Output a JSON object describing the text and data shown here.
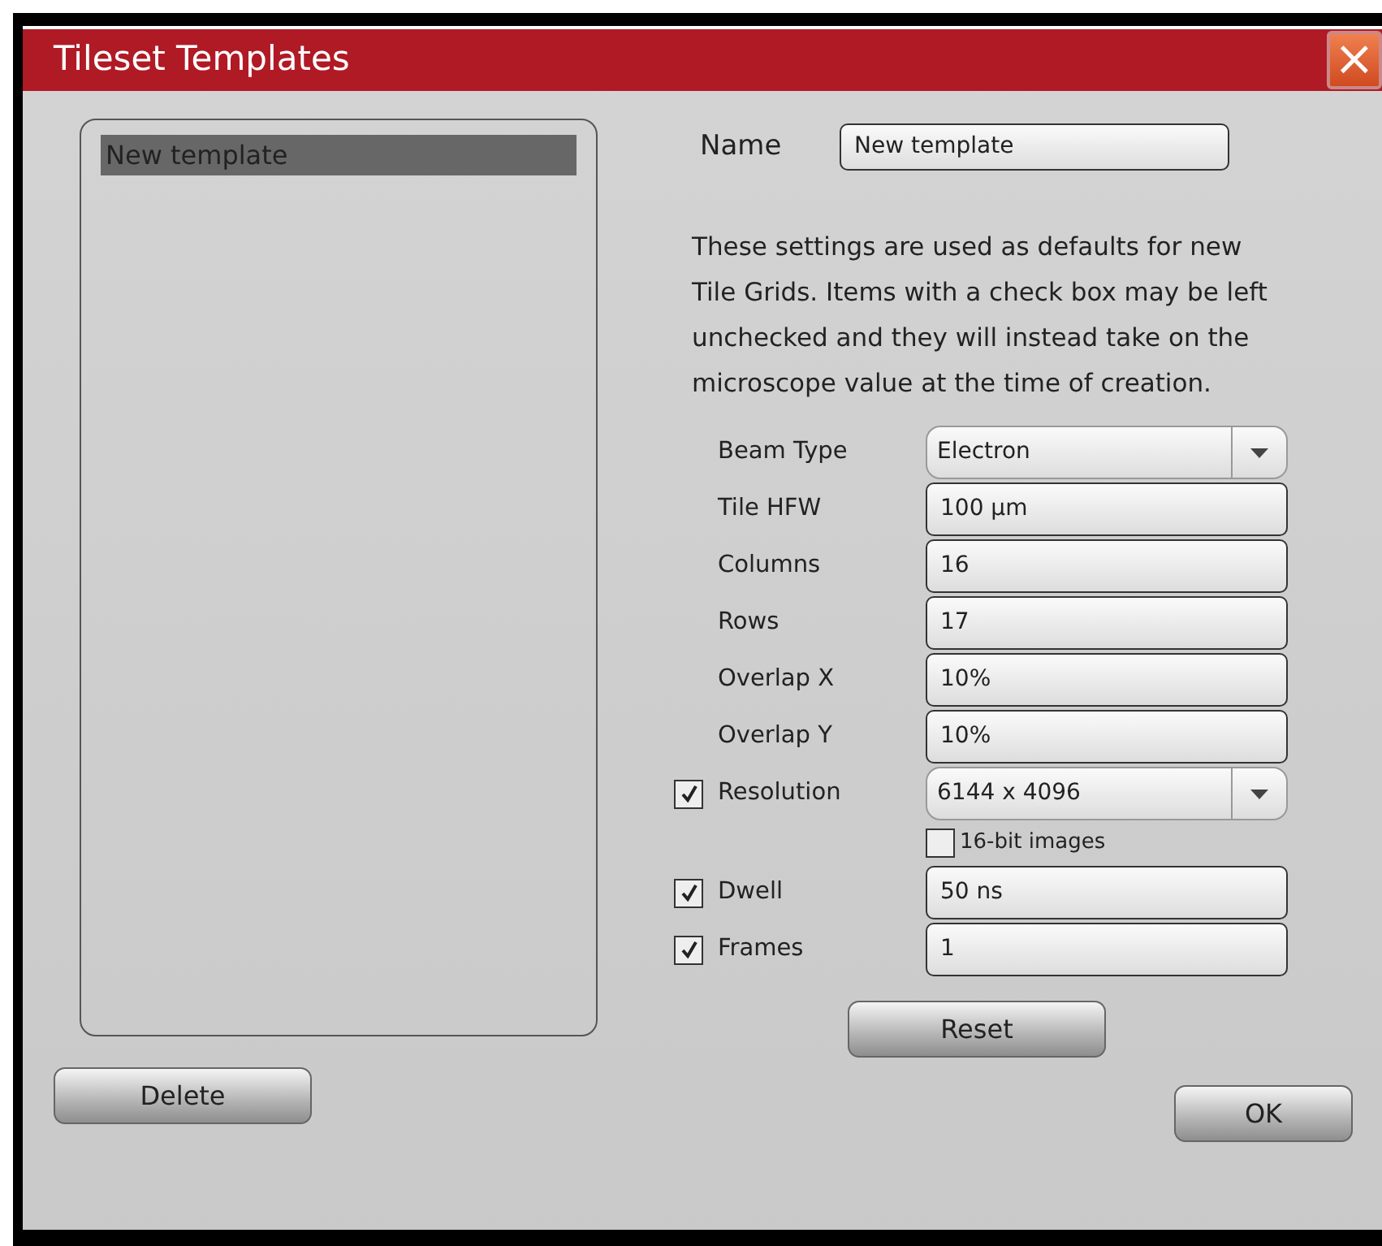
{
  "window": {
    "title": "Tileset Templates",
    "close": "×"
  },
  "templates": [
    {
      "label": "New template",
      "selected": true
    }
  ],
  "name": {
    "label": "Name",
    "value": "New template"
  },
  "description": "These settings are used as defaults for new Tile Grids. Items with a check box may be left unchecked and they will instead take on the microscope value at the time of creation.",
  "fields": [
    {
      "kind": "dropdown",
      "label": "Beam Type",
      "value": "Electron"
    },
    {
      "kind": "text",
      "label": "Tile HFW",
      "value": "100 µm"
    },
    {
      "kind": "text",
      "label": "Columns",
      "value": "16"
    },
    {
      "kind": "text",
      "label": "Rows",
      "value": "17"
    },
    {
      "kind": "text",
      "label": "Overlap X",
      "value": "10%"
    },
    {
      "kind": "text",
      "label": "Overlap Y",
      "value": "10%"
    },
    {
      "kind": "dropdown",
      "label": "Resolution",
      "value": "6144 x 4096",
      "toggle": {
        "checked": true
      }
    },
    {
      "kind": "option",
      "label": "16-bit images",
      "checked": false
    },
    {
      "kind": "text",
      "label": "Dwell",
      "value": "50 ns",
      "toggle": {
        "checked": true
      }
    },
    {
      "kind": "text",
      "label": "Frames",
      "value": "1",
      "toggle": {
        "checked": true
      }
    }
  ],
  "buttons": {
    "delete": "Delete",
    "reset": "Reset",
    "ok": "OK"
  }
}
